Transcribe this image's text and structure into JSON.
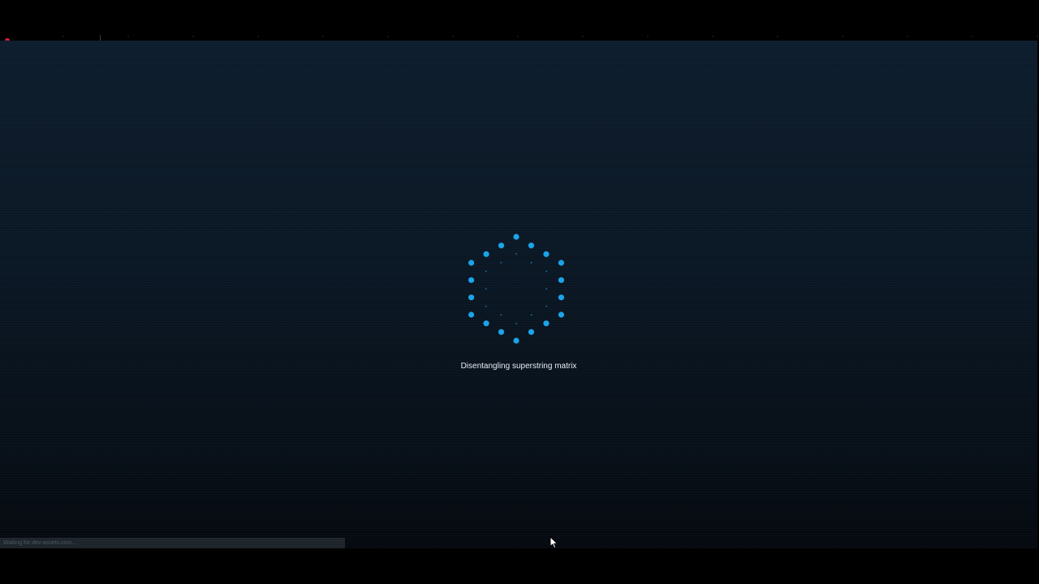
{
  "loader": {
    "message": "Disentangling superstring matrix",
    "spinner_color": "#1aa3e8"
  },
  "status_bar": {
    "text": "Waiting for dev-assets.com..."
  },
  "colors": {
    "stage_top": "#0d1d2d",
    "stage_bottom": "#05090f",
    "letterbox": "#000000",
    "marker": "#d0223a"
  },
  "icons": {
    "spinner": "loading-spinner-icon",
    "cursor": "mouse-pointer-icon"
  }
}
